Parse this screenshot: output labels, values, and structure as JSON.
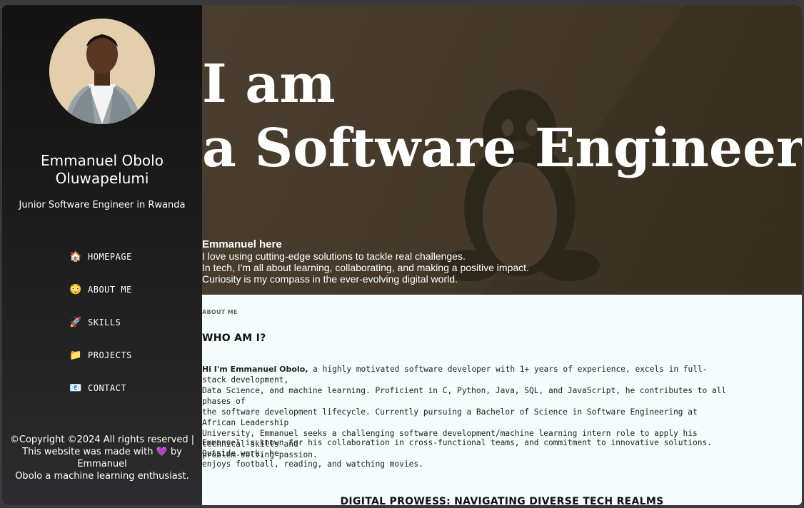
{
  "sidebar": {
    "name": "Emmanuel Obolo Oluwapelumi",
    "role": "Junior Software Engineer in Rwanda",
    "nav": [
      {
        "icon": "🏠",
        "label": "HOMEPAGE"
      },
      {
        "icon": "😳",
        "label": "ABOUT ME"
      },
      {
        "icon": "🚀",
        "label": "SKILLS"
      },
      {
        "icon": "📁",
        "label": "PROJECTS"
      },
      {
        "icon": "📧",
        "label": "CONTACT"
      }
    ],
    "footer": {
      "copyright": "©Copyright ©2024 All rights reserved |",
      "made_with_prefix": "This website was made with",
      "heart": "💜",
      "made_with_suffix": "by",
      "author": "Emmanuel",
      "tagline": "Obolo a machine learning enthusiast."
    }
  },
  "hero": {
    "title_line1": "I am",
    "title_line2": "a Software Engineer",
    "greeting": "Emmanuel here",
    "lines": [
      "I love using cutting-edge solutions to tackle real challenges.",
      "In tech, I'm all about learning, collaborating, and making a positive impact.",
      "Curiosity is my compass in the ever-evolving digital world."
    ]
  },
  "about": {
    "kicker": "ABOUT ME",
    "heading": "WHO AM I?",
    "para1_bold": "Hi I'm Emmanuel Obolo,",
    "para1_line1": " a highly motivated software developer with 1+ years of experience, excels in full-stack development,",
    "para1_line2": "Data Science, and machine learning. Proficient in C, Python, Java, SQL, and JavaScript, he contributes to all phases of",
    "para1_line3": "the software development lifecycle. Currently pursuing a Bachelor of Science in Software Engineering at African Leadership",
    "para1_line4": "University, Emmanuel seeks a challenging software development/machine learning intern role to apply his technical skills and",
    "para1_line5": "problem-solving passion.",
    "para2_line1": "Emmanuel is known for his collaboration in cross-functional teams, and commitment to innovative solutions. Outside work, he",
    "para2_line2": "enjoys football, reading, and watching movies.",
    "next_section": "DIGITAL PROWESS: NAVIGATING DIVERSE TECH REALMS"
  }
}
